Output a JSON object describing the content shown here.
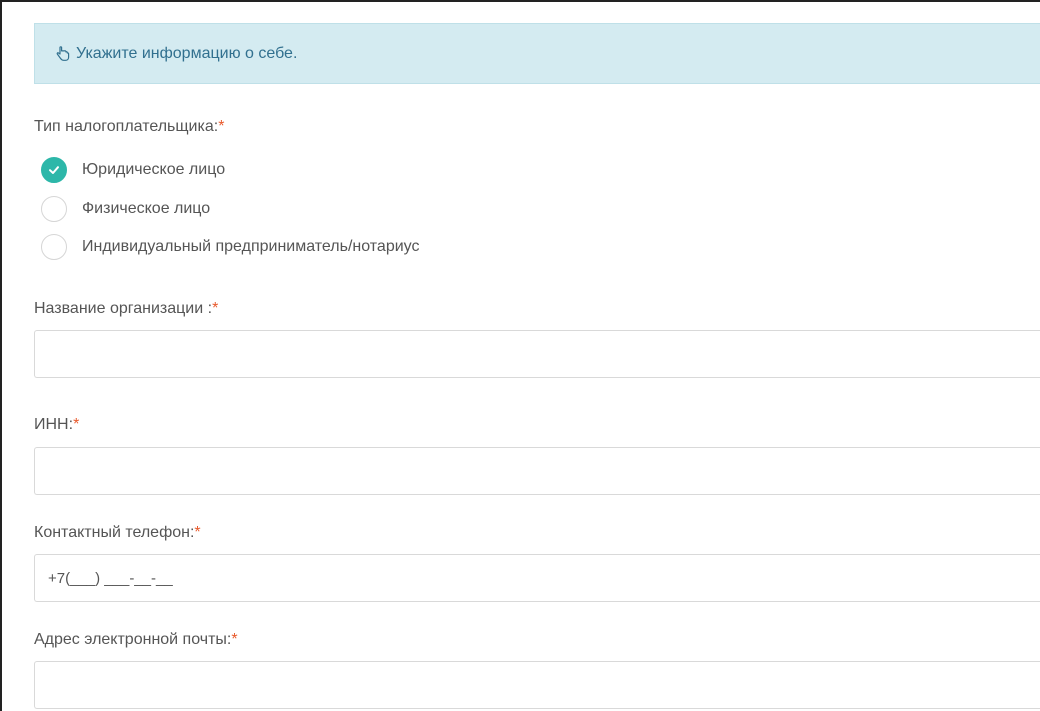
{
  "banner": {
    "text": "Укажите информацию о себе."
  },
  "taxpayer_type": {
    "label": "Тип налогоплательщика:",
    "required_mark": "*",
    "options": [
      {
        "label": "Юридическое лицо",
        "checked": true
      },
      {
        "label": "Физическое лицо",
        "checked": false
      },
      {
        "label": "Индивидуальный предприниматель/нотариус",
        "checked": false
      }
    ]
  },
  "organization_name": {
    "label": "Название организации :",
    "required_mark": "*",
    "value": ""
  },
  "inn": {
    "label": "ИНН:",
    "required_mark": "*",
    "value": ""
  },
  "phone": {
    "label": "Контактный телефон:",
    "required_mark": "*",
    "placeholder": "+7(___) ___-__-__"
  },
  "email": {
    "label": "Адрес электронной почты:",
    "required_mark": "*",
    "value": ""
  },
  "colors": {
    "banner_bg": "#d4ebf1",
    "banner_text": "#31708f",
    "radio_checked": "#2db7a9",
    "required": "#e8592b"
  },
  "icons": {
    "banner": "hand-pointing-icon",
    "radio_checked": "checkmark-icon"
  }
}
